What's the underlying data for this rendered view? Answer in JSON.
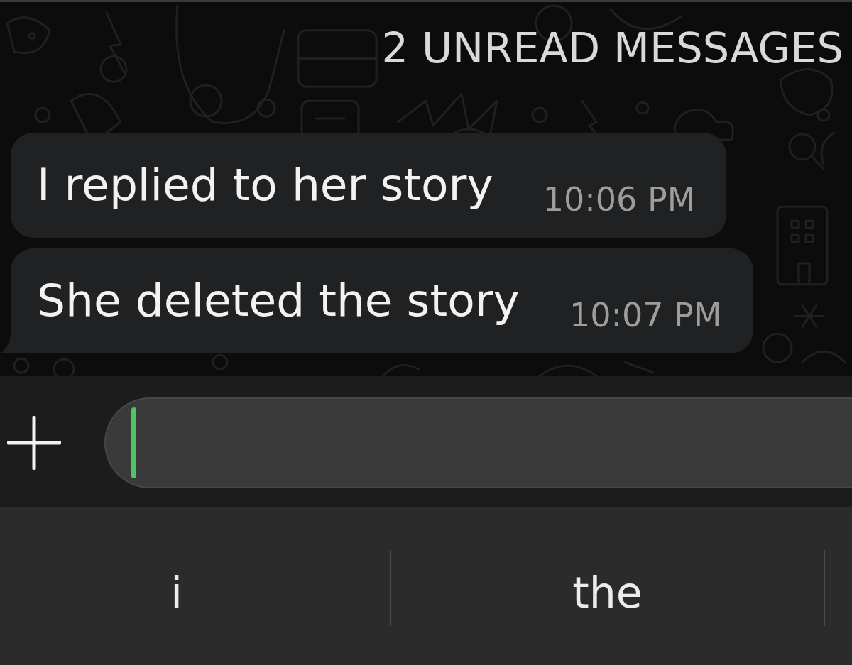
{
  "unread_banner": {
    "text": "2 UNREAD MESSAGES"
  },
  "messages": [
    {
      "text": "I replied to her story",
      "time": "10:06 PM",
      "tail": false
    },
    {
      "text": "She deleted the story",
      "time": "10:07 PM",
      "tail": true
    }
  ],
  "composer": {
    "focused": true
  },
  "suggestions": [
    {
      "label": "i"
    },
    {
      "label": "the"
    }
  ]
}
